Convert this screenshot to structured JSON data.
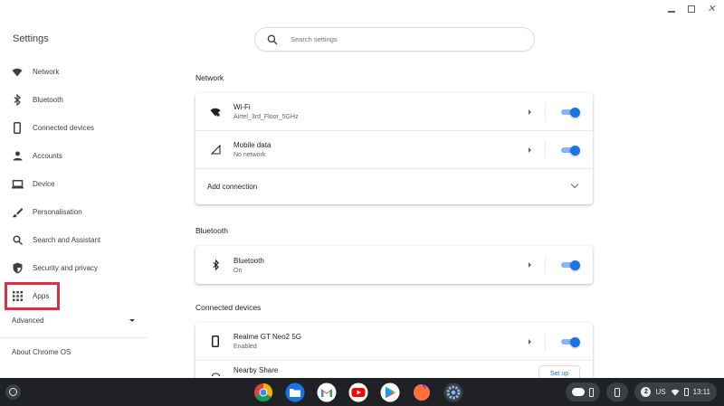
{
  "window": {
    "minimize": "minimize",
    "maximize": "maximize",
    "close": "close"
  },
  "sidebar": {
    "title": "Settings",
    "items": [
      {
        "label": "Network",
        "icon": "wifi-icon"
      },
      {
        "label": "Bluetooth",
        "icon": "bluetooth-icon"
      },
      {
        "label": "Connected devices",
        "icon": "phone-icon"
      },
      {
        "label": "Accounts",
        "icon": "person-icon"
      },
      {
        "label": "Device",
        "icon": "laptop-icon"
      },
      {
        "label": "Personalisation",
        "icon": "brush-icon"
      },
      {
        "label": "Search and Assistant",
        "icon": "search-icon"
      },
      {
        "label": "Security and privacy",
        "icon": "shield-icon"
      },
      {
        "label": "Apps",
        "icon": "apps-grid-icon"
      }
    ],
    "advanced": "Advanced",
    "about": "About Chrome OS"
  },
  "search": {
    "placeholder": "Search settings"
  },
  "main": {
    "network": {
      "title": "Network",
      "wifi": {
        "title": "Wi-Fi",
        "subtitle": "Airtel_3rd_Floor_5GHz",
        "enabled": true
      },
      "mobile": {
        "title": "Mobile data",
        "subtitle": "No network",
        "enabled": true
      },
      "add_connection": "Add connection"
    },
    "bluetooth": {
      "title": "Bluetooth",
      "row": {
        "title": "Bluetooth",
        "subtitle": "On",
        "enabled": true
      }
    },
    "connected": {
      "title": "Connected devices",
      "phone": {
        "title": "Realme GT Neo2 5G",
        "subtitle": "Enabled",
        "enabled": true
      },
      "nearby": {
        "title": "Nearby Share",
        "button": "Set up"
      }
    }
  },
  "shelf": {
    "apps": [
      "chrome-icon",
      "files-icon",
      "gmail-icon",
      "youtube-icon",
      "play-store-icon",
      "firefox-icon",
      "settings-icon"
    ],
    "tray": {
      "notifications": "2",
      "locale": "US",
      "time": "13:11"
    }
  },
  "colors": {
    "accent": "#1a73e8",
    "highlight": "#dd2e44",
    "shelf": "#202124"
  }
}
